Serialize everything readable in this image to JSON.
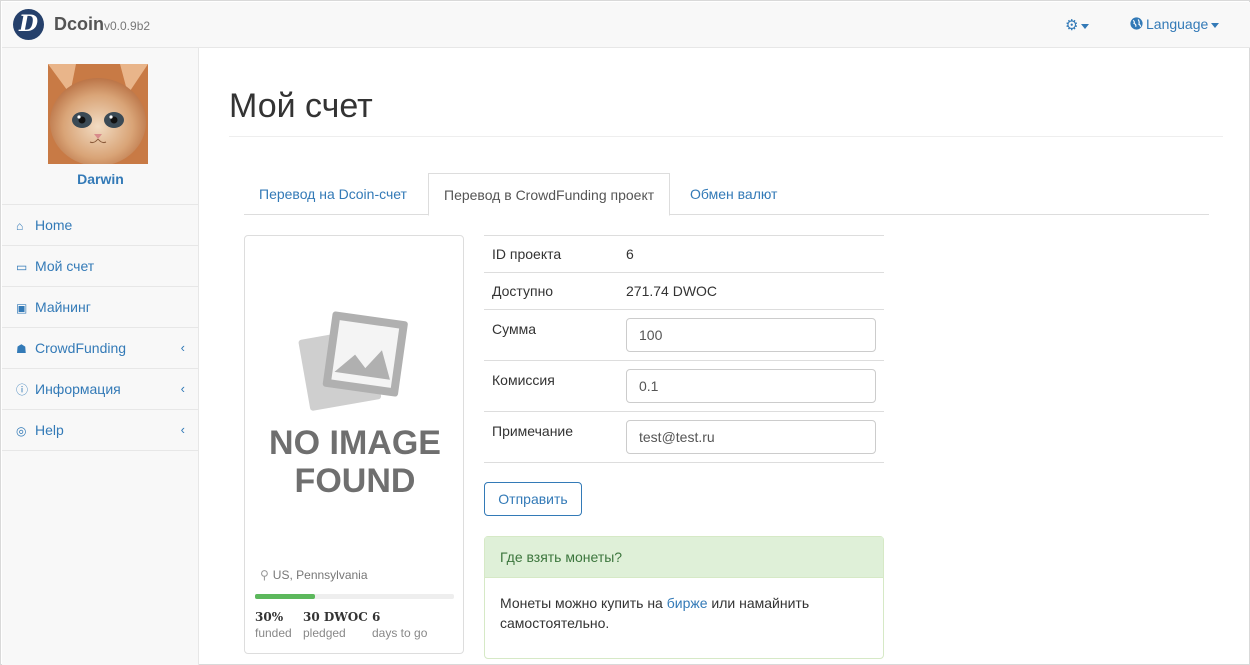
{
  "brand": {
    "logo_letter": "D",
    "name": "Dcoin",
    "version": "v0.0.9b2"
  },
  "topnav": {
    "settings_icon": "gear-icon",
    "language_label": "Language",
    "language_icon": "globe-icon"
  },
  "sidebar": {
    "username": "Darwin",
    "items": [
      {
        "label": "Home",
        "icon": "home-icon",
        "has_arrow": false
      },
      {
        "label": "Мой счет",
        "icon": "credit-card-icon",
        "has_arrow": false
      },
      {
        "label": "Майнинг",
        "icon": "money-icon",
        "has_arrow": false
      },
      {
        "label": "CrowdFunding",
        "icon": "users-icon",
        "has_arrow": true
      },
      {
        "label": "Информация",
        "icon": "info-icon",
        "has_arrow": true
      },
      {
        "label": "Help",
        "icon": "life-ring-icon",
        "has_arrow": true
      }
    ]
  },
  "page": {
    "title": "Мой счет"
  },
  "tabs": [
    {
      "label": "Перевод на Dcoin-счет",
      "active": false
    },
    {
      "label": "Перевод в CrowdFunding проект",
      "active": true
    },
    {
      "label": "Обмен валют",
      "active": false
    }
  ],
  "project": {
    "image_line1": "NO IMAGE",
    "image_line2": "FOUND",
    "location": "US, Pennsylvania",
    "funded_pct": 30,
    "funded_value": "30%",
    "funded_label": "funded",
    "pledged_value": "30 DWOC",
    "pledged_label": "pledged",
    "days_value": "6",
    "days_label": "days to go"
  },
  "form": {
    "project_id_label": "ID проекта",
    "project_id_value": "6",
    "available_label": "Доступно",
    "available_value": "271.74 DWOC",
    "amount_label": "Сумма",
    "amount_value": "100",
    "fee_label": "Комиссия",
    "fee_value": "0.1",
    "note_label": "Примечание",
    "note_value": "test@test.ru",
    "submit_label": "Отправить"
  },
  "help_panel": {
    "heading": "Где взять монеты?",
    "text_before": "Монеты можно купить на ",
    "link_label": "бирже",
    "text_after": " или намайнить самостоятельно."
  },
  "colors": {
    "accent": "#337ab7",
    "progress": "#5cb85c",
    "panel_bg": "#dff0d8",
    "logo_bg": "#25406b"
  }
}
